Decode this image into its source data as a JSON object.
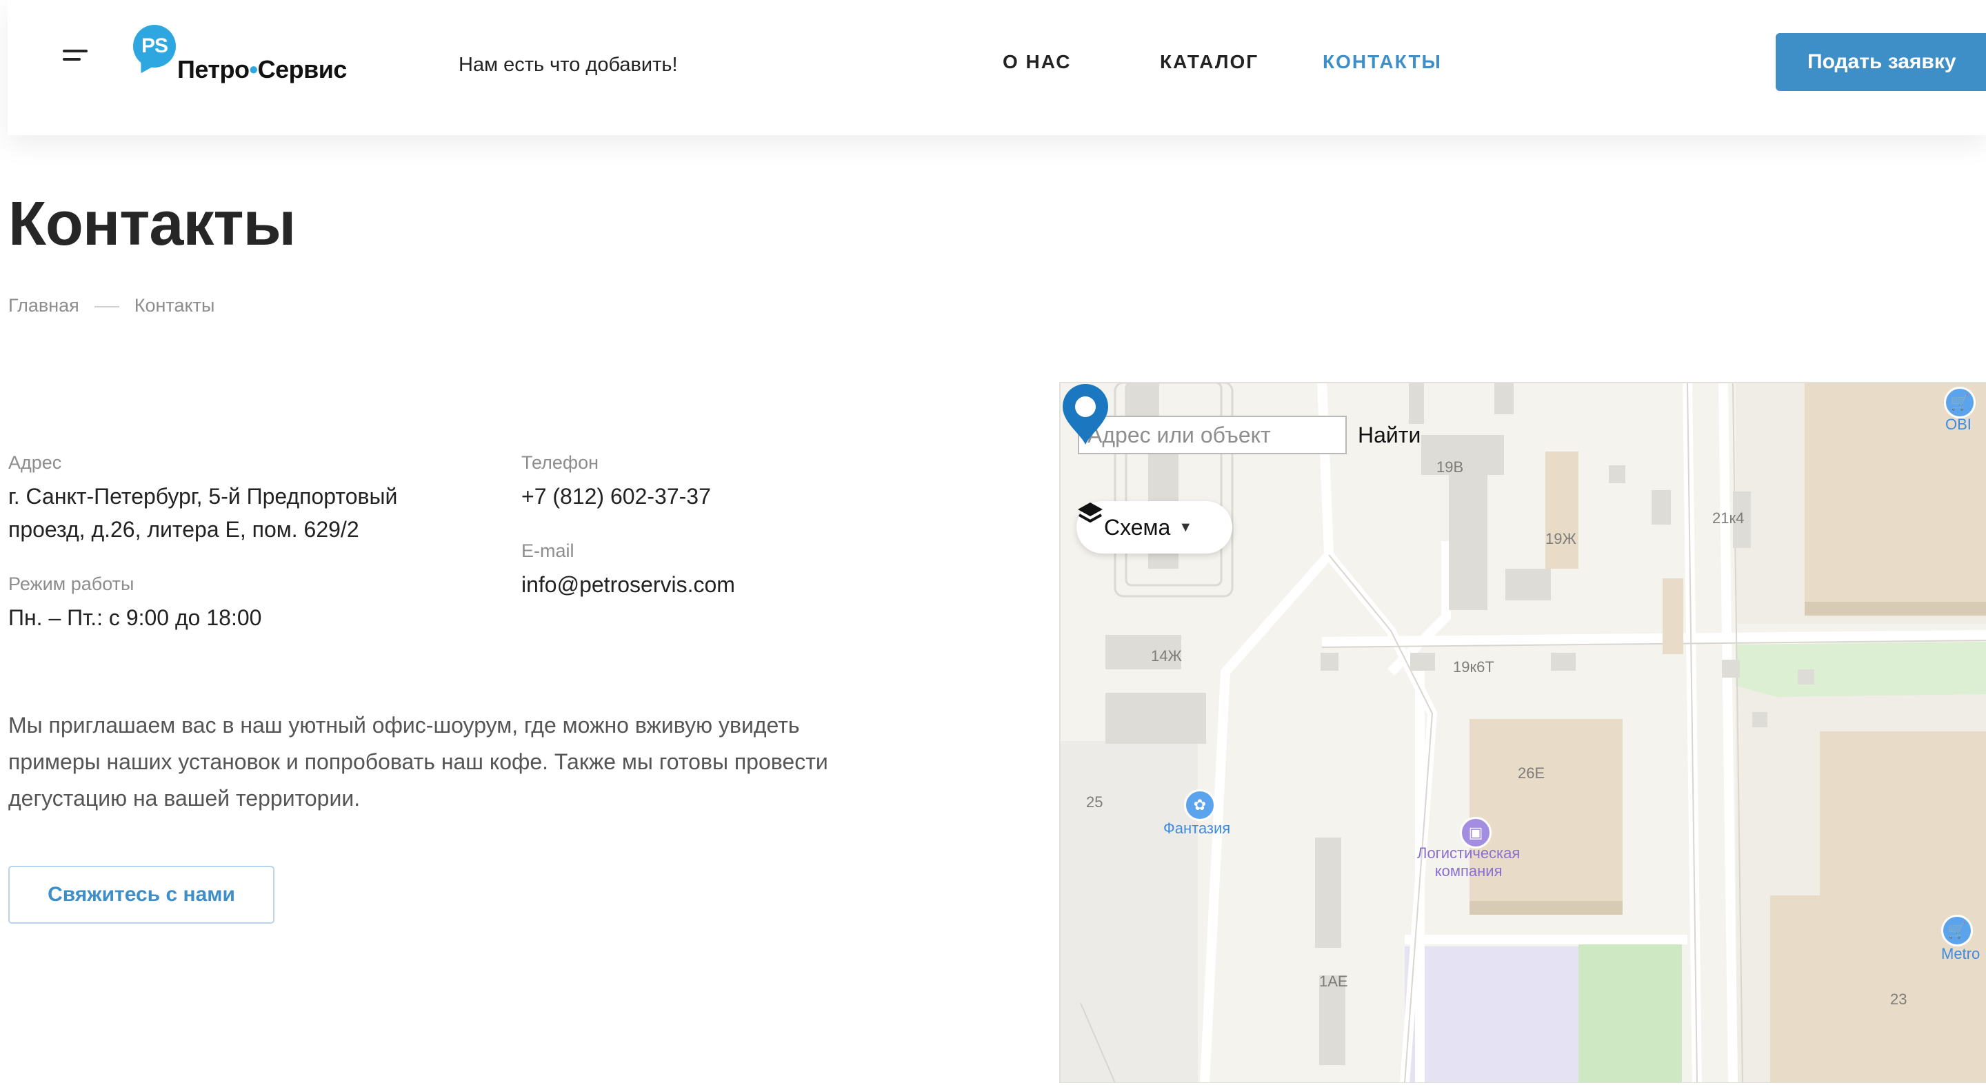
{
  "header": {
    "logo_badge": "PS",
    "logo_name_part1": "Петро",
    "logo_dot": "•",
    "logo_name_part2": "Сервис",
    "tagline": "Нам есть что добавить!",
    "nav": [
      {
        "label": "О НАС",
        "active": false
      },
      {
        "label": "КАТАЛОГ",
        "active": false
      },
      {
        "label": "КОНТАКТЫ",
        "active": true
      }
    ],
    "cta_label": "Подать заявку"
  },
  "page": {
    "title": "Контакты",
    "breadcrumb": [
      "Главная",
      "Контакты"
    ]
  },
  "contacts": {
    "address_label": "Адрес",
    "address_line1": "г. Санкт-Петербург, 5-й Предпортовый",
    "address_line2": "проезд, д.26, литера Е, пом. 629/2",
    "hours_label": "Режим работы",
    "hours_value": "Пн. – Пт.: с 9:00 до 18:00",
    "phone_label": "Телефон",
    "phone_value": "+7 (812) 602-37-37",
    "email_label": "E-mail",
    "email_value": "info@petroservis.com"
  },
  "intro": {
    "line1": "Мы приглашаем вас в наш уютный офис-шоурум, где можно вживую увидеть",
    "line2": "примеры наших установок и попробовать наш кофе. Также мы готовы провести",
    "line3": "дегустацию на вашей территории."
  },
  "contact_button": "Свяжитесь с нами",
  "map": {
    "search_placeholder": "Адрес или объект",
    "find_label": "Найти",
    "layers_label": "Схема",
    "buildings": [
      "19В",
      "21к4",
      "19Ж",
      "14Ж",
      "19к6Т",
      "26Е",
      "25",
      "1АЕ",
      "23"
    ],
    "pois": [
      "OBI",
      "Фантазия",
      "Логистическая",
      "компания",
      "Metro"
    ],
    "icons": {
      "layers": "layers-icon",
      "caret": "caret-down-icon",
      "pin": "location-pin-icon"
    }
  },
  "colors": {
    "accent": "#3e8fc8",
    "logo_blue": "#2ea7e0",
    "title": "#262626",
    "muted": "#8d8d8d"
  }
}
